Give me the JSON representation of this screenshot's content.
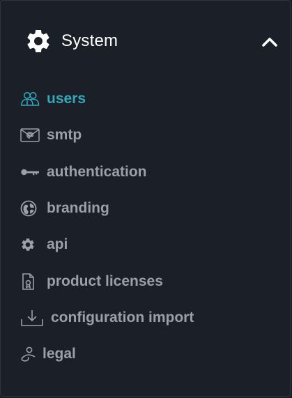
{
  "section": {
    "title": "System",
    "icon": "gear-icon",
    "expanded": true
  },
  "menu": {
    "items": [
      {
        "label": "users",
        "icon": "users-icon",
        "active": true
      },
      {
        "label": "smtp",
        "icon": "envelope-at-icon",
        "active": false
      },
      {
        "label": "authentication",
        "icon": "key-icon",
        "active": false
      },
      {
        "label": "branding",
        "icon": "brand-globe-icon",
        "active": false
      },
      {
        "label": "api",
        "icon": "cog-icon",
        "active": false
      },
      {
        "label": "product licenses",
        "icon": "license-document-icon",
        "active": false
      },
      {
        "label": "configuration import",
        "icon": "download-tray-icon",
        "active": false
      },
      {
        "label": "legal",
        "icon": "legal-icon",
        "active": false
      }
    ]
  },
  "colors": {
    "background": "#1b1f28",
    "active": "#33a6b8",
    "inactive": "#9aa0a9",
    "header_text": "#ffffff"
  }
}
